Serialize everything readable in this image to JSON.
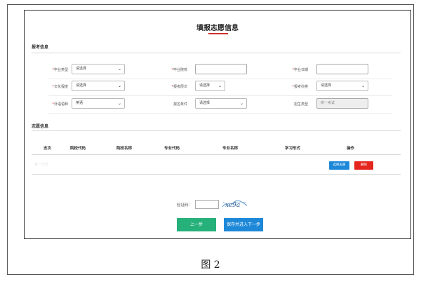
{
  "page": {
    "title": "填报志愿信息"
  },
  "registration": {
    "section_title": "报考信息",
    "fields": [
      {
        "label": "毕业类型",
        "value": "请选择",
        "kind": "select"
      },
      {
        "label": "毕业院校",
        "value": "",
        "kind": "input"
      },
      {
        "label": "毕业日期",
        "value": "",
        "kind": "input"
      },
      {
        "label": "文化程度",
        "value": "请选择",
        "kind": "select"
      },
      {
        "label": "报考层次",
        "value": "请选择",
        "kind": "select"
      },
      {
        "label": "报考科类",
        "value": "请选择",
        "kind": "select"
      },
      {
        "label": "外语语种",
        "value": "英语",
        "kind": "select"
      },
      {
        "label": "报名条件",
        "value": "请选择",
        "kind": "select"
      },
      {
        "label": "招生类型",
        "value": "统一考试",
        "kind": "disabled"
      }
    ]
  },
  "volunteer": {
    "section_title": "志愿信息",
    "columns": [
      "志次",
      "院校代码",
      "院校名称",
      "专业代码",
      "专业名称",
      "学习形式",
      "操作"
    ],
    "row": {
      "faint_text": "第一志愿"
    },
    "select_button": "选择志愿",
    "delete_button": "删除"
  },
  "captcha": {
    "label": "验证码：",
    "image_text": "xc9a"
  },
  "actions": {
    "prev": "上一步",
    "next": "保存并进入下一步"
  },
  "caption": "图 2",
  "colors": {
    "accent": "#d0312d",
    "blue": "#1e88d8",
    "green": "#26b07a",
    "red": "#e5261e"
  }
}
